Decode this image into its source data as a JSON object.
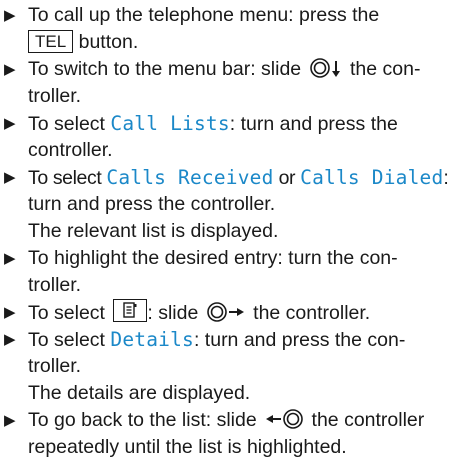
{
  "steps": [
    {
      "lines": [
        {
          "before": "To call up the telephone menu: press the"
        },
        {
          "key": "TEL",
          "after": " button."
        }
      ]
    },
    {
      "lines": [
        {
          "before": "To switch to the menu bar: slide ",
          "after": " the con-"
        },
        {
          "before": "troller."
        }
      ]
    },
    {
      "lines": [
        {
          "before": "To select ",
          "mono": "Call Lists",
          "after": ": turn and press the"
        },
        {
          "before": "controller."
        }
      ]
    },
    {
      "lines": [
        {
          "before": "To select ",
          "mono": "Calls Received",
          "mid": " or ",
          "mono2": "Calls Dialed",
          "after": ":"
        },
        {
          "before": "turn and press the controller."
        },
        {
          "before": "The relevant list is displayed."
        }
      ]
    },
    {
      "lines": [
        {
          "before": "To highlight the desired entry: turn the con-"
        },
        {
          "before": "troller."
        }
      ]
    },
    {
      "lines": [
        {
          "before": "To select ",
          "mid": ": slide ",
          "after": " the controller."
        }
      ]
    },
    {
      "lines": [
        {
          "before": "To select ",
          "mono": "Details",
          "after": ": turn and press the con-"
        },
        {
          "before": "troller."
        },
        {
          "before": "The details are displayed."
        }
      ]
    },
    {
      "lines": [
        {
          "before": "To go back to the list: slide ",
          "after": " the controller"
        },
        {
          "before": "repeatedly until the list is highlighted."
        }
      ]
    }
  ],
  "icons": {
    "bullet": "triangle-arrow-icon",
    "controller": "controller-icon",
    "menu": "phonebook-icon"
  }
}
